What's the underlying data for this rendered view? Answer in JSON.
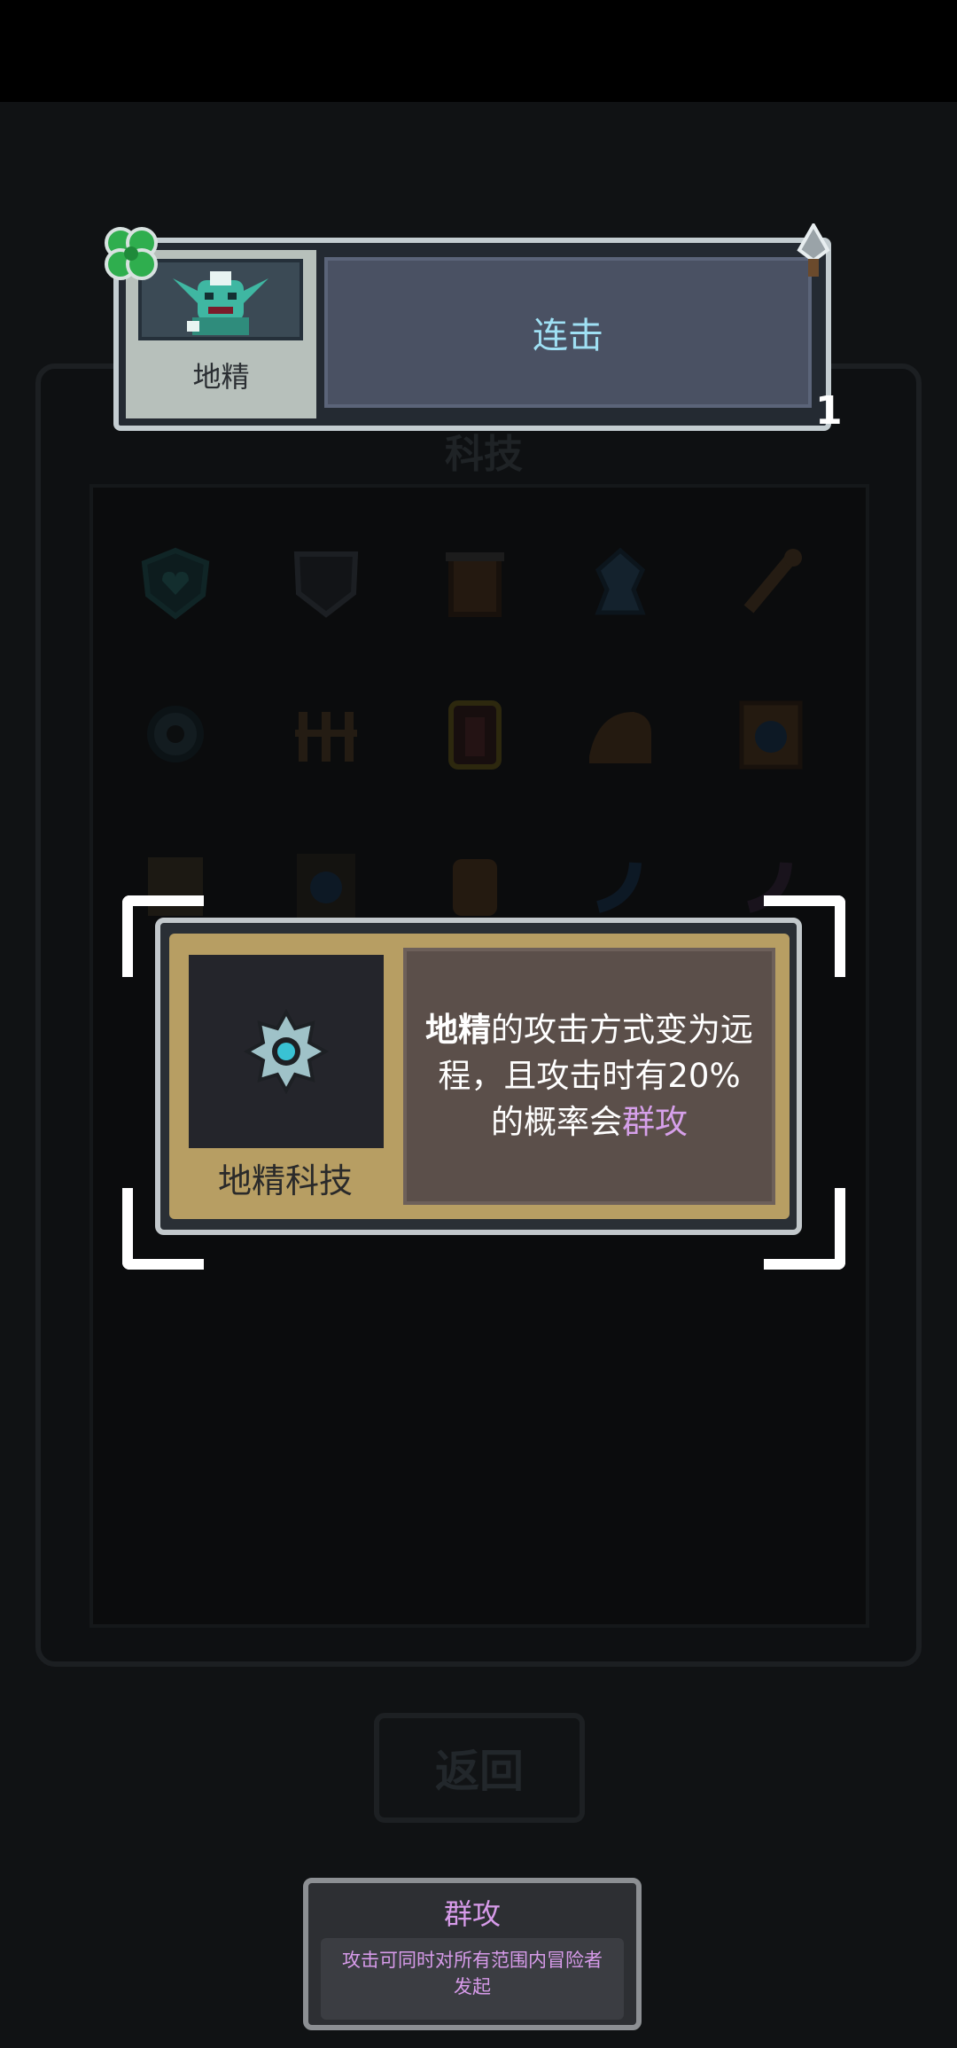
{
  "top_card": {
    "character_name": "地精",
    "skill_name": "连击",
    "level": "1",
    "portrait_icon": "goblin-icon"
  },
  "background": {
    "panel_title": "科技",
    "back_button_label": "返回"
  },
  "selected_card": {
    "name": "地精科技",
    "icon": "gear-icon",
    "description_parts": {
      "subject": "地精",
      "text": "的攻击方式变为远程，且攻击时有20%的概率会",
      "keyword": "群攻"
    },
    "colors": {
      "keyword": "#d6a0ea",
      "card_frame": "#b79e63"
    }
  },
  "tooltip": {
    "title": "群攻",
    "body": "攻击可同时对所有范围内冒险者发起"
  }
}
